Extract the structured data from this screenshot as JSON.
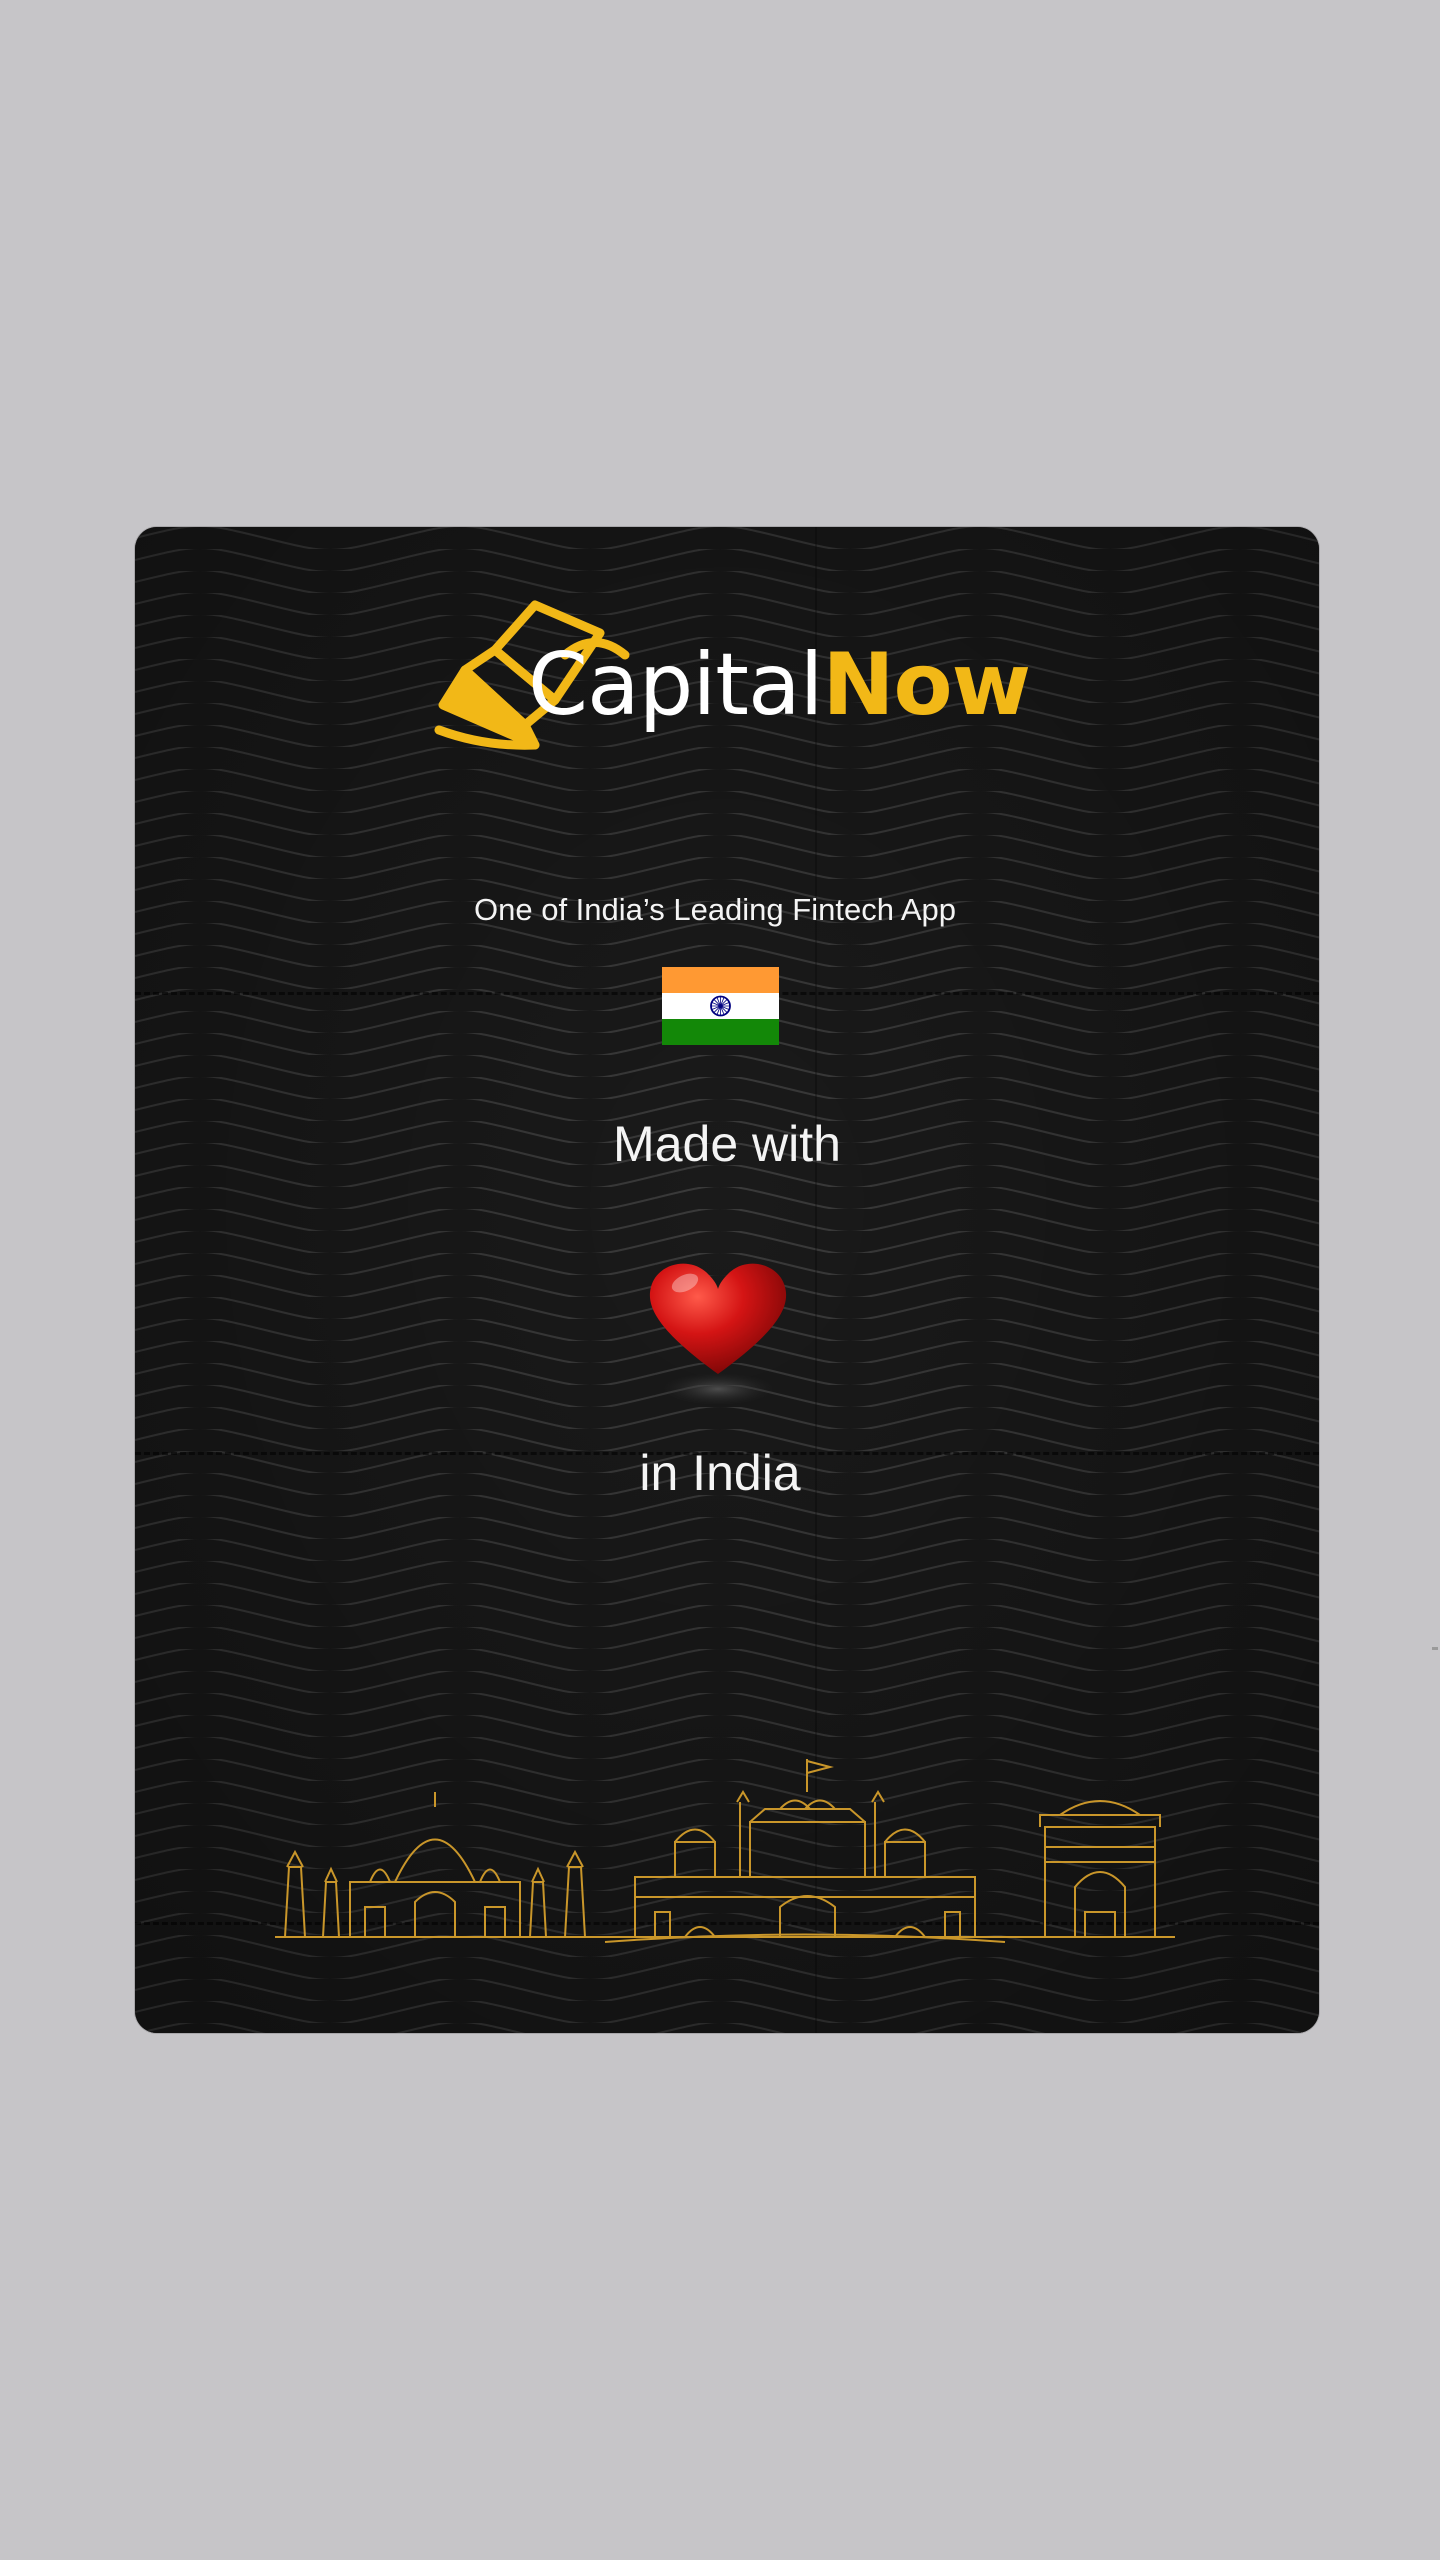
{
  "brand": {
    "name_part1": "Capital",
    "name_part2": "Now"
  },
  "tagline": "One of India’s Leading Fintech App",
  "made_with": "Made with",
  "in_india": "in India",
  "colors": {
    "background": "#c6c5c8",
    "card": "#191919",
    "brand_gold": "#f2b817",
    "heart_red": "#d41414",
    "flag_saffron": "#ff9933",
    "flag_green": "#138808",
    "chakra_blue": "#000080"
  },
  "icons": {
    "logo": "money-fan-icon",
    "flag": "india-flag-icon",
    "heart": "heart-icon",
    "skyline": "india-monuments-illustration"
  }
}
